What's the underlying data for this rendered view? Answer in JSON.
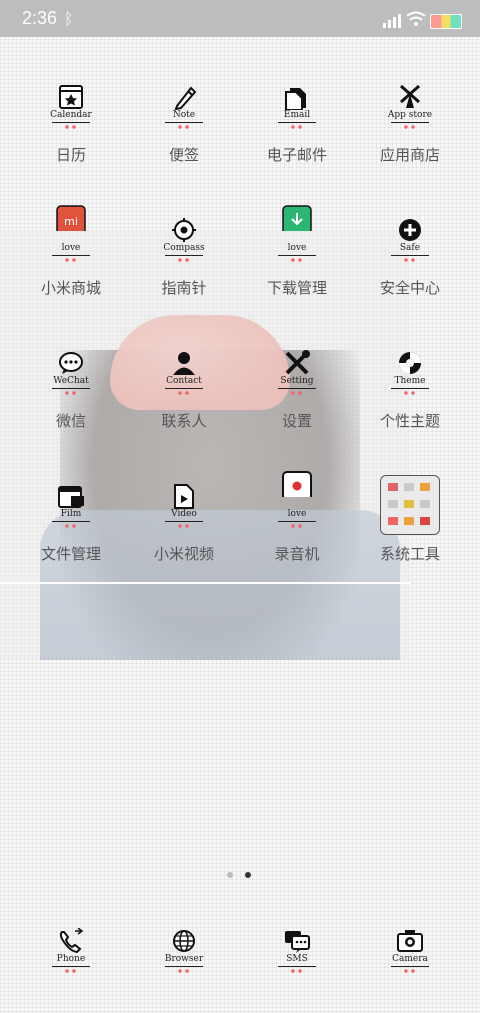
{
  "status_bar": {
    "time": "2:36",
    "bluetooth": "ᛒ"
  },
  "apps": [
    {
      "sub": "Calendar",
      "label": "日历",
      "icon": "calendar-star-icon"
    },
    {
      "sub": "Note",
      "label": "便签",
      "icon": "pencil-icon"
    },
    {
      "sub": "Email",
      "label": "电子邮件",
      "icon": "document-icon"
    },
    {
      "sub": "App store",
      "label": "应用商店",
      "icon": "windmill-icon"
    },
    {
      "sub": "love",
      "label": "小米商城",
      "icon": "mi-icon"
    },
    {
      "sub": "Compass",
      "label": "指南针",
      "icon": "compass-icon"
    },
    {
      "sub": "love",
      "label": "下载管理",
      "icon": "download-icon"
    },
    {
      "sub": "Safe",
      "label": "安全中心",
      "icon": "shield-plus-icon"
    },
    {
      "sub": "WeChat",
      "label": "微信",
      "icon": "chat-bubble-icon"
    },
    {
      "sub": "Contact",
      "label": "联系人",
      "icon": "person-icon"
    },
    {
      "sub": "Setting",
      "label": "设置",
      "icon": "tools-icon"
    },
    {
      "sub": "Theme",
      "label": "个性主题",
      "icon": "lifebuoy-icon"
    },
    {
      "sub": "Film",
      "label": "文件管理",
      "icon": "folder-window-icon"
    },
    {
      "sub": "Video",
      "label": "小米视频",
      "icon": "video-file-icon"
    },
    {
      "sub": "love",
      "label": "录音机",
      "icon": "record-icon"
    },
    {
      "sub": "",
      "label": "系统工具",
      "icon": "folder-icon"
    }
  ],
  "dock": [
    {
      "sub": "Phone",
      "icon": "phone-icon"
    },
    {
      "sub": "Browser",
      "icon": "globe-icon"
    },
    {
      "sub": "SMS",
      "icon": "sms-icon"
    },
    {
      "sub": "Camera",
      "icon": "camera-icon"
    }
  ],
  "colors": {
    "status_bg": "#bdbdbd",
    "accent_red": "#e0533d",
    "accent_green": "#2bb673",
    "record_red": "#e0302f",
    "dot_active": "#333333",
    "dot_inactive": "#bdbdbd"
  },
  "page_indicator": {
    "count": 2,
    "active": 2
  }
}
